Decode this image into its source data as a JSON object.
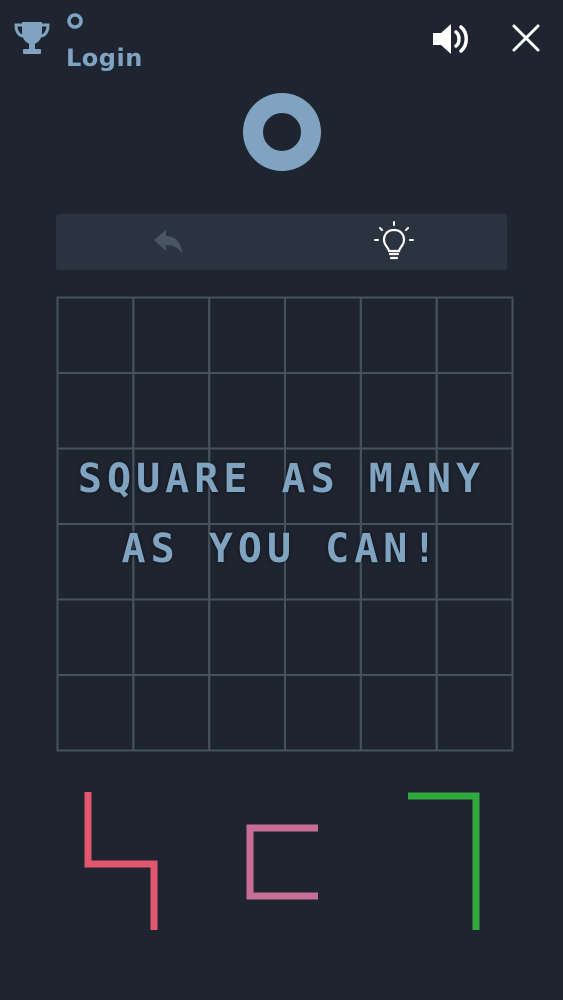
{
  "header": {
    "login_label": "Login",
    "icons": [
      "trophy-icon",
      "score-ring-icon",
      "sound-icon",
      "close-icon"
    ]
  },
  "score": {
    "display": "O"
  },
  "toolbar": {
    "icons": [
      "undo-icon",
      "hint-lightbulb-icon"
    ]
  },
  "board": {
    "rows": 6,
    "cols": 6
  },
  "message": {
    "line1": "SQUARE AS MANY",
    "line2": "AS YOU CAN!"
  },
  "pieces": [
    {
      "id": "piece-1",
      "shape": "z-step",
      "color": "#e0576f"
    },
    {
      "id": "piece-2",
      "shape": "c-bracket",
      "color": "#c86e96"
    },
    {
      "id": "piece-3",
      "shape": "corner",
      "color": "#2fa83d"
    }
  ],
  "colors": {
    "background": "#1f2530",
    "accent": "#7fa3c0",
    "grid_line": "#46525e",
    "toolbar_bg": "#2b3340",
    "icon_dim": "#4a5563",
    "icon_white": "#ffffff"
  }
}
